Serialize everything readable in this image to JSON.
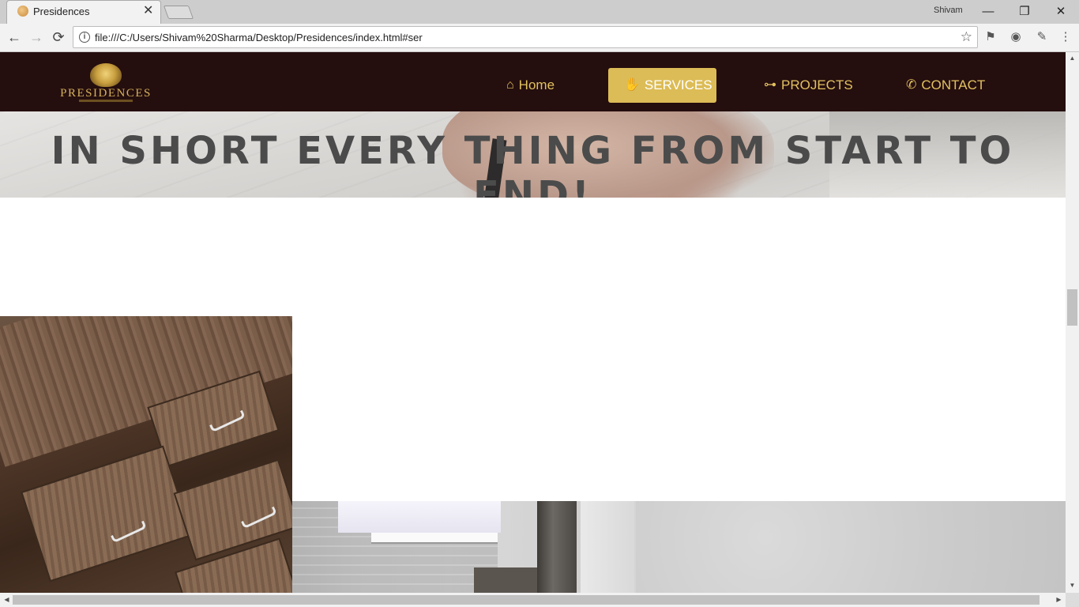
{
  "browser": {
    "tab_title": "Presidences",
    "tab_close": "✕",
    "profile_name": "Shivam",
    "url": "file:///C:/Users/Shivam%20Sharma/Desktop/Presidences/index.html#ser",
    "window_buttons": {
      "minimize": "—",
      "restore": "❐",
      "close": "✕"
    },
    "nav": {
      "back": "←",
      "forward": "→",
      "reload": "⟳"
    },
    "star": "☆"
  },
  "site": {
    "logo_text": "PRESIDENCES",
    "nav": [
      {
        "label": "Home",
        "icon": "home-icon",
        "glyph": "⌂",
        "active": false
      },
      {
        "label": "SERVICES",
        "icon": "handshake-icon",
        "glyph": "✋",
        "active": true
      },
      {
        "label": "PROJECTS",
        "icon": "sitemap-icon",
        "glyph": "⊶",
        "active": false
      },
      {
        "label": "CONTACT",
        "icon": "phone-icon",
        "glyph": "✆",
        "active": false
      }
    ],
    "hero_title": "IN SHORT EVERY THING FROM START TO END!"
  },
  "colors": {
    "header_bg": "#250e0e",
    "accent_gold": "#dcbc56",
    "nav_text": "#e2c160",
    "hero_text": "#4b4b4b"
  }
}
